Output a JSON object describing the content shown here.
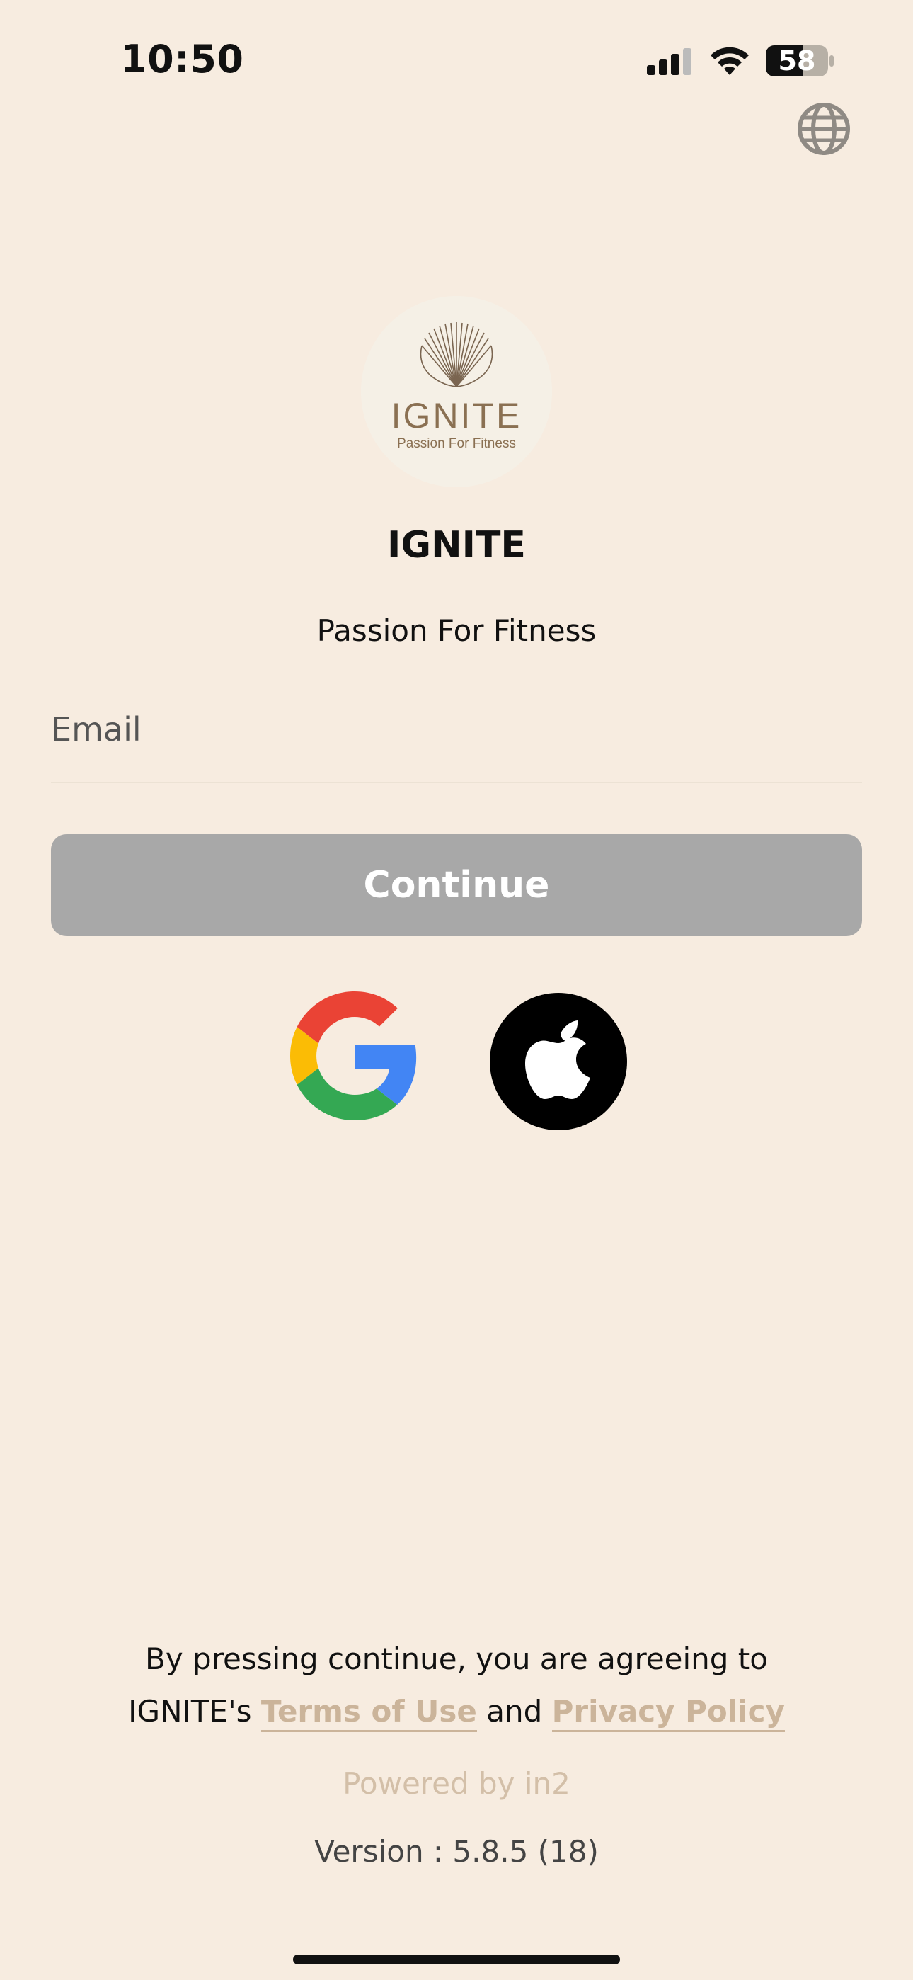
{
  "status_bar": {
    "time": "10:50",
    "battery": "58",
    "signal_icon": "cellular-signal-icon",
    "wifi_icon": "wifi-icon",
    "battery_icon": "battery-icon"
  },
  "language_button": {
    "icon": "globe-icon"
  },
  "logo": {
    "wordmark": "IGNITE",
    "tagline": "Passion For Fitness",
    "color": "#8a7052"
  },
  "header": {
    "title": "IGNITE",
    "subtitle": "Passion For Fitness"
  },
  "form": {
    "email_placeholder": "Email",
    "email_value": "",
    "continue_label": "Continue"
  },
  "social": {
    "google_icon": "google-icon",
    "apple_icon": "apple-icon"
  },
  "footer": {
    "agree_line1": "By pressing continue, you are agreeing to",
    "agree_prefix": "IGNITE's",
    "terms_label": "Terms of Use",
    "and_word": "and",
    "privacy_label": "Privacy Policy",
    "powered_by": "Powered by in2",
    "version": "Version : 5.8.5 (18)"
  },
  "colors": {
    "background": "#f7ece0",
    "button_disabled": "#a8a8a8",
    "link": "#cbb49a"
  }
}
